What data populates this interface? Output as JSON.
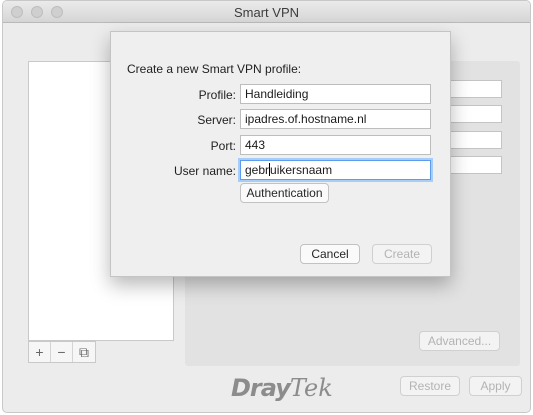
{
  "window": {
    "title": "Smart VPN"
  },
  "sidebar": {
    "add_label": "+",
    "remove_label": "−",
    "duplicate_label": "⧉"
  },
  "main": {
    "advanced_label": "Advanced...",
    "restore_label": "Restore",
    "apply_label": "Apply"
  },
  "brand": {
    "part1": "Dray",
    "part2": "Tek"
  },
  "dialog": {
    "heading": "Create a new Smart VPN profile:",
    "profile": {
      "label": "Profile:",
      "value": "Handleiding"
    },
    "server": {
      "label": "Server:",
      "value": "ipadres.of.hostname.nl"
    },
    "port": {
      "label": "Port:",
      "value": "443"
    },
    "username": {
      "label": "User name:",
      "value_before_cursor": "gebr",
      "value_after_cursor": "uikersnaam"
    },
    "authentication_label": "Authentication",
    "cancel_label": "Cancel",
    "create_label": "Create"
  }
}
